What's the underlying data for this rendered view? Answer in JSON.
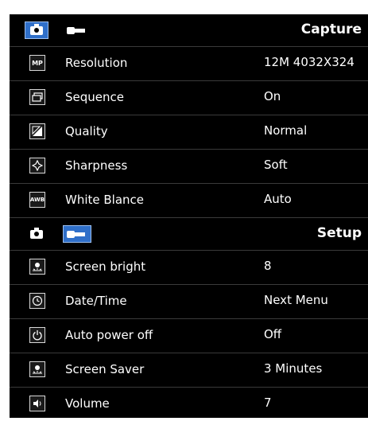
{
  "capture": {
    "title": "Capture",
    "rows": [
      {
        "icon": "mp-icon",
        "icon_text": "MP",
        "label": "Resolution",
        "value": "12M   4032X324"
      },
      {
        "icon": "sequence-icon",
        "icon_text": "",
        "label": "Sequence",
        "value": "On"
      },
      {
        "icon": "quality-icon",
        "icon_text": "",
        "label": "Quality",
        "value": "Normal"
      },
      {
        "icon": "sharpness-icon",
        "icon_text": "",
        "label": "Sharpness",
        "value": "Soft"
      },
      {
        "icon": "white-balance-icon",
        "icon_text": "AWB",
        "label": "White Blance",
        "value": "Auto"
      }
    ]
  },
  "setup": {
    "title": "Setup",
    "rows": [
      {
        "icon": "brightness-icon",
        "icon_text": "",
        "label": "Screen bright",
        "value": "8"
      },
      {
        "icon": "clock-icon",
        "icon_text": "",
        "label": "Date/Time",
        "value": "Next Menu"
      },
      {
        "icon": "power-icon",
        "icon_text": "",
        "label": "Auto power off",
        "value": "Off"
      },
      {
        "icon": "screen-saver-icon",
        "icon_text": "",
        "label": "Screen Saver",
        "value": "3 Minutes"
      },
      {
        "icon": "speaker-icon",
        "icon_text": "",
        "label": "Volume",
        "value": "7"
      }
    ]
  },
  "colors": {
    "accent": "#2f6fc9",
    "background": "#000000",
    "text": "#ffffff"
  }
}
